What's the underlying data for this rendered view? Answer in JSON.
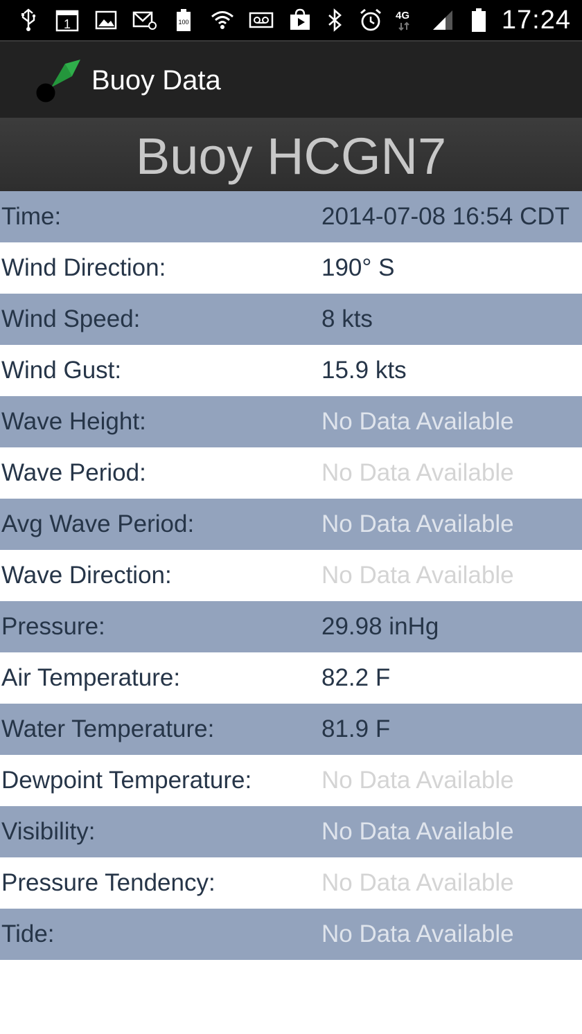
{
  "status_bar": {
    "time": "17:24",
    "icons": [
      "usb-icon",
      "calendar-icon",
      "gallery-icon",
      "email-icon",
      "battery-100-icon",
      "wifi-icon",
      "voicemail-icon",
      "play-store-icon",
      "bluetooth-icon",
      "alarm-icon",
      "4g-lte-icon",
      "signal-icon",
      "battery-icon"
    ],
    "calendar_day": "1",
    "battery_badge": "100",
    "network_label": "4G"
  },
  "action_bar": {
    "title": "Buoy Data"
  },
  "buoy": {
    "title": "Buoy HCGN7"
  },
  "rows": [
    {
      "label": "Time:",
      "value": "2014-07-08 16:54 CDT",
      "available": true
    },
    {
      "label": "Wind Direction:",
      "value": "190° S",
      "available": true
    },
    {
      "label": "Wind Speed:",
      "value": "8 kts",
      "available": true
    },
    {
      "label": "Wind Gust:",
      "value": "15.9 kts",
      "available": true
    },
    {
      "label": "Wave Height:",
      "value": "No Data Available",
      "available": false
    },
    {
      "label": "Wave Period:",
      "value": "No Data Available",
      "available": false
    },
    {
      "label": "Avg Wave Period:",
      "value": "No Data Available",
      "available": false
    },
    {
      "label": "Wave Direction:",
      "value": "No Data Available",
      "available": false
    },
    {
      "label": "Pressure:",
      "value": "29.98 inHg",
      "available": true
    },
    {
      "label": "Air Temperature:",
      "value": "82.2 F",
      "available": true
    },
    {
      "label": "Water Temperature:",
      "value": "81.9 F",
      "available": true
    },
    {
      "label": "Dewpoint Temperature:",
      "value": "No Data Available",
      "available": false
    },
    {
      "label": "Visibility:",
      "value": "No Data Available",
      "available": false
    },
    {
      "label": "Pressure Tendency:",
      "value": "No Data Available",
      "available": false
    },
    {
      "label": "Tide:",
      "value": "No Data Available",
      "available": false
    }
  ],
  "colors": {
    "row_shade": "#93a3bd",
    "text": "#263548",
    "app_icon_green": "#2fae4a"
  }
}
